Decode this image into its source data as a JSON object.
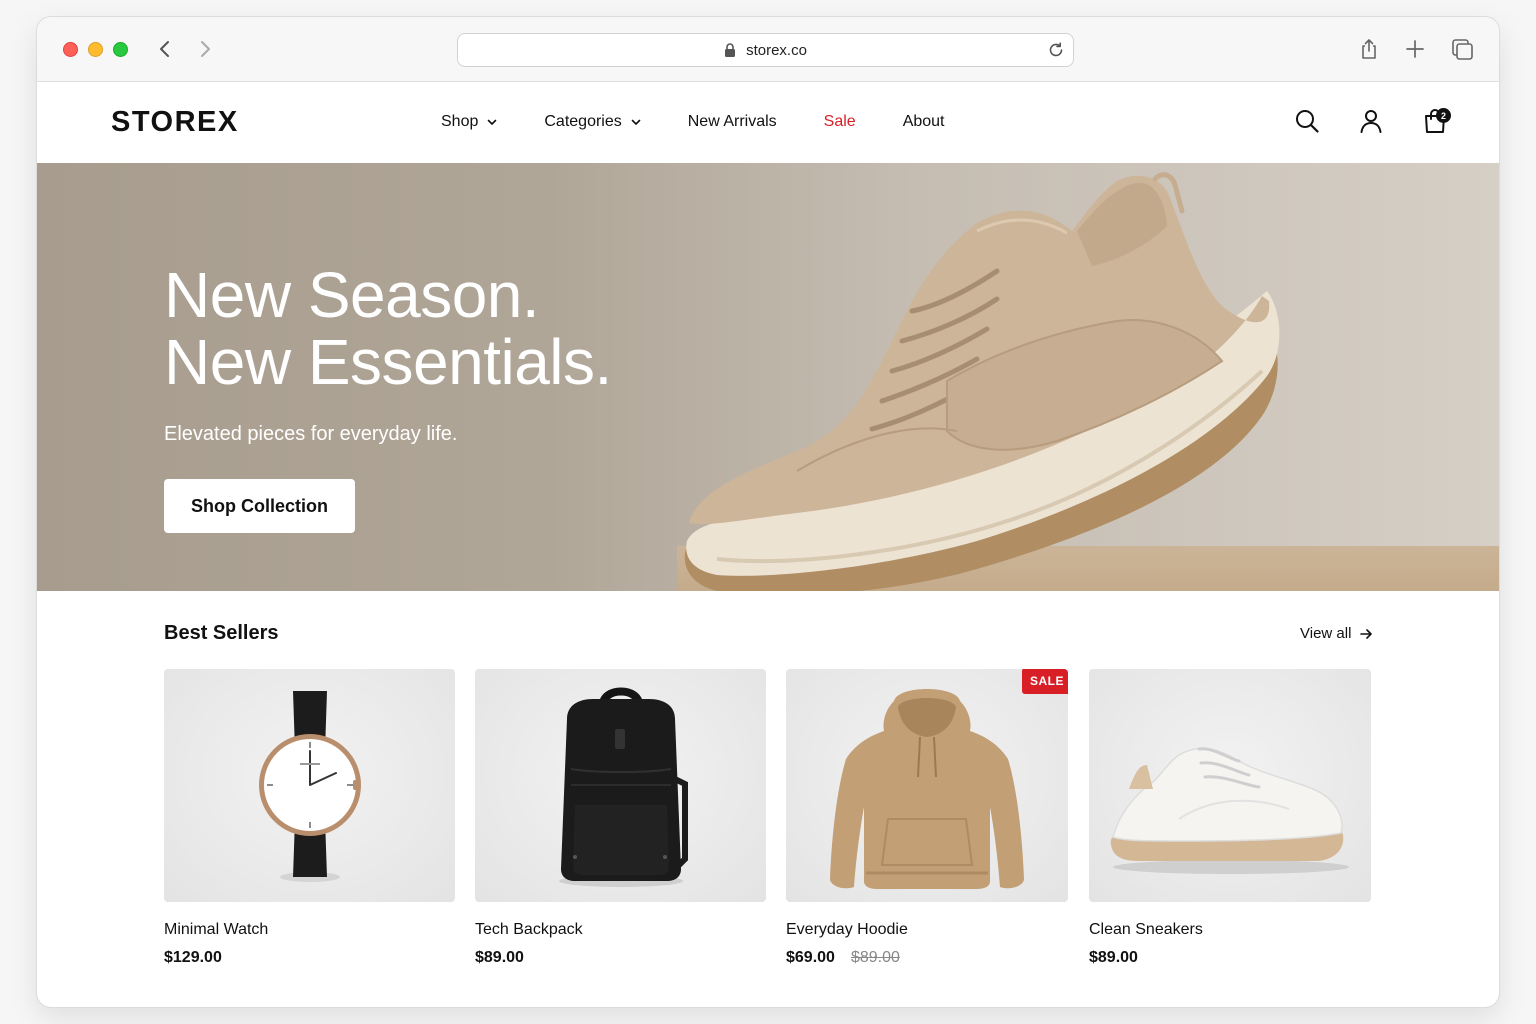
{
  "browser": {
    "url": "storex.co",
    "icons": [
      "back-icon",
      "forward-icon",
      "lock-icon",
      "reload-icon",
      "share-icon",
      "plus-icon",
      "tabs-icon"
    ]
  },
  "header": {
    "logo": "STOREX",
    "nav": [
      {
        "label": "Shop",
        "has_dropdown": true
      },
      {
        "label": "Categories",
        "has_dropdown": true
      },
      {
        "label": "New Arrivals",
        "has_dropdown": false
      },
      {
        "label": "Sale",
        "has_dropdown": false,
        "color": "#d81f26"
      },
      {
        "label": "About",
        "has_dropdown": false
      }
    ],
    "cart_count": "2",
    "icons": [
      "search-icon",
      "user-icon",
      "bag-icon"
    ]
  },
  "hero": {
    "title_line1": "New Season.",
    "title_line2": "New Essentials.",
    "subtitle": "Elevated pieces for everyday life.",
    "cta_label": "Shop Collection"
  },
  "best_sellers": {
    "title": "Best Sellers",
    "view_all_label": "View all",
    "products": [
      {
        "name": "Minimal Watch",
        "price": "$129.00",
        "old_price": "",
        "badge": ""
      },
      {
        "name": "Tech Backpack",
        "price": "$89.00",
        "old_price": "",
        "badge": ""
      },
      {
        "name": "Everyday Hoodie",
        "price": "$69.00",
        "old_price": "$89.00",
        "badge": "SALE"
      },
      {
        "name": "Clean Sneakers",
        "price": "$89.00",
        "old_price": "",
        "badge": ""
      }
    ]
  },
  "colors": {
    "sale_red": "#d81f26",
    "hero_bg": "#b0a698",
    "text": "#111111"
  }
}
